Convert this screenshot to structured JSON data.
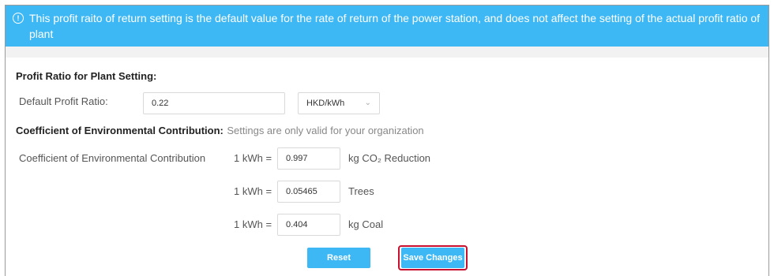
{
  "banner": {
    "icon": "info-icon",
    "message": "This profit raito of return setting is the default value for the rate of return of the power station, and does not affect the setting of the actual profit ratio of plant"
  },
  "profit_section": {
    "title": "Profit Ratio for Plant Setting:",
    "default_label": "Default Profit Ratio:",
    "default_value": "0.22",
    "unit_selected": "HKD/kWh"
  },
  "env_section": {
    "title": "Coefficient of Environmental Contribution:",
    "note": "Settings are only valid for your organization",
    "row_label": "Coefficient of Environmental Contribution",
    "rows": [
      {
        "prefix": "1 kWh =",
        "value": "0.997",
        "unit": "kg CO₂ Reduction"
      },
      {
        "prefix": "1 kWh =",
        "value": "0.05465",
        "unit": "Trees"
      },
      {
        "prefix": "1 kWh =",
        "value": "0.404",
        "unit": "kg Coal"
      }
    ]
  },
  "actions": {
    "reset_label": "Reset",
    "save_label": "Save Changes"
  },
  "colors": {
    "accent": "#3db8f4",
    "highlight_outline": "#c8102e"
  }
}
